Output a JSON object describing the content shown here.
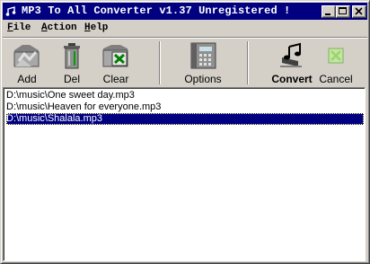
{
  "window": {
    "title": "MP3 To All Converter v1.37 Unregistered !"
  },
  "titlebar_buttons": [
    "minimize-button",
    "maximize-button",
    "close-button"
  ],
  "menu": [
    {
      "pre": "",
      "key": "F",
      "post": "ile"
    },
    {
      "pre": "",
      "key": "A",
      "post": "ction"
    },
    {
      "pre": "",
      "key": "H",
      "post": "elp"
    }
  ],
  "toolbar": {
    "add": "Add",
    "del": "Del",
    "clear": "Clear",
    "options": "Options",
    "convert": "Convert",
    "cancel": "Cancel"
  },
  "files": [
    "D:\\music\\One sweet day.mp3",
    "D:\\music\\Heaven for everyone.mp3",
    "D:\\music\\Shalala.mp3"
  ],
  "selected_index": 2,
  "colors": {
    "title_bg": "#000080",
    "selection_bg": "#000080",
    "face": "#d4d0c8"
  }
}
